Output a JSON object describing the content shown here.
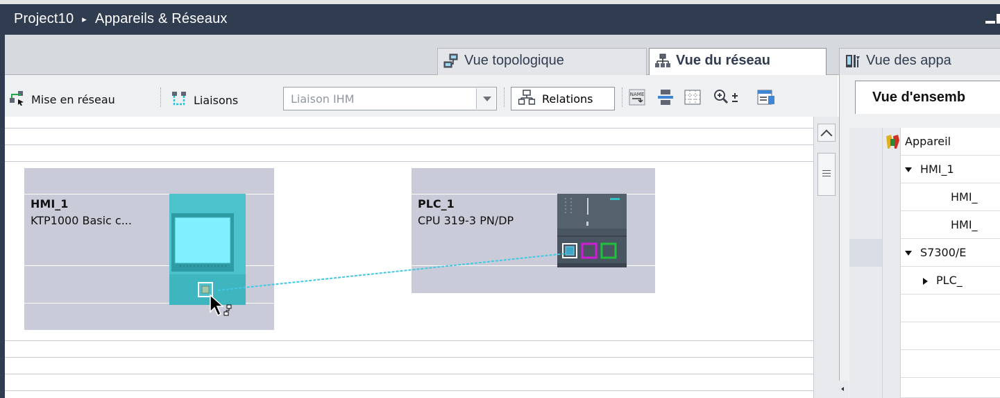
{
  "titlebar": {
    "project": "Project10",
    "separator": "▸",
    "section": "Appareils & Réseaux"
  },
  "view_tabs": [
    {
      "label": "Vue topologique",
      "icon": "topology-view-icon",
      "active": false
    },
    {
      "label": "Vue du réseau",
      "icon": "network-view-icon",
      "active": true
    },
    {
      "label": "Vue des appa",
      "icon": "device-view-icon",
      "active": false
    }
  ],
  "toolbar": {
    "networking_label": "Mise en réseau",
    "connections_label": "Liaisons",
    "connection_type_value": "Liaison IHM",
    "relations_label": "Relations",
    "name_icon_text": "NAME"
  },
  "devices": [
    {
      "name": "HMI_1",
      "type": "KTP1000 Basic c..."
    },
    {
      "name": "PLC_1",
      "type": "CPU 319-3 PN/DP"
    }
  ],
  "overview": {
    "tab_label": "Vue d'ensemb",
    "column_header": "Appareil",
    "rows": [
      {
        "label": "HMI_1",
        "level": 1,
        "expander": "down"
      },
      {
        "label": "HMI_",
        "level": 2,
        "expander": "none"
      },
      {
        "label": "HMI_",
        "level": 2,
        "expander": "none"
      },
      {
        "label": "S7300/E",
        "level": 1,
        "expander": "down"
      },
      {
        "label": "PLC_",
        "level": 2,
        "expander": "right"
      }
    ]
  },
  "colors": {
    "titlebar_bg": "#303c4f",
    "device_box": "#c9ccd8",
    "hmi_device": "#4cc3cc",
    "plc_device": "#4a5562",
    "connection_line": "#3fc8e4",
    "port_magenta": "#d11ad8",
    "port_green": "#1fc23a"
  }
}
